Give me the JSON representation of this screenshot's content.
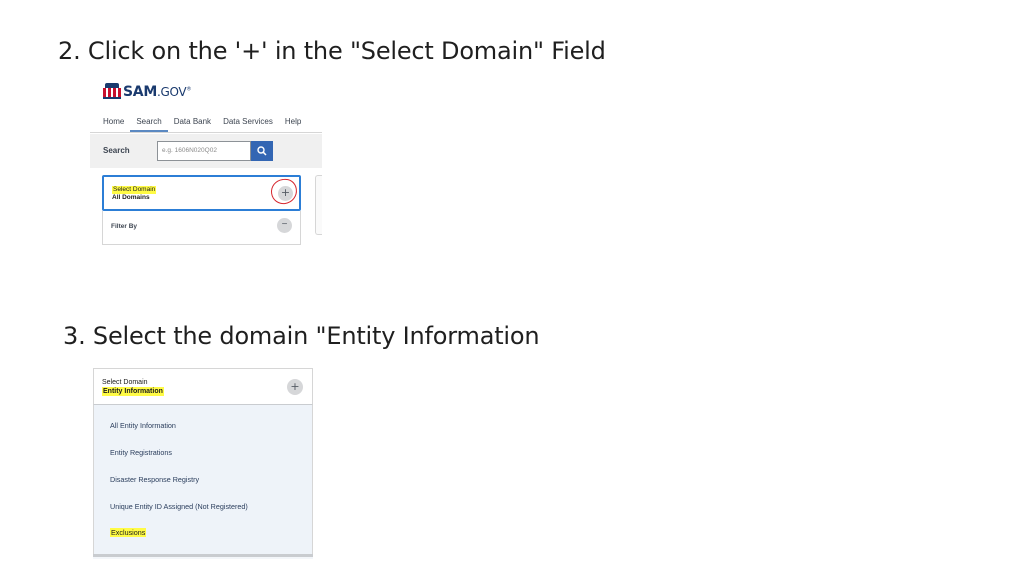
{
  "steps": {
    "step2": "2. Click on the '+' in the \"Select Domain\" Field",
    "step3": "3. Select the domain \"Entity Information"
  },
  "screenshot1": {
    "logo": {
      "main": "SAM",
      "suffix": ".GOV",
      "mark": "®"
    },
    "nav": [
      "Home",
      "Search",
      "Data Bank",
      "Data Services",
      "Help"
    ],
    "nav_active": "Search",
    "search": {
      "label": "Search",
      "placeholder": "e.g. 1606N020Q02"
    },
    "domain": {
      "label": "Select Domain",
      "value": "All Domains",
      "button": "+"
    },
    "filter": {
      "label": "Filter By",
      "button": "−"
    }
  },
  "screenshot2": {
    "domain": {
      "label": "Select Domain",
      "value": "Entity Information",
      "button": "+"
    },
    "options": [
      "All Entity Information",
      "Entity Registrations",
      "Disaster Response Registry",
      "Unique Entity ID Assigned (Not Registered)",
      "Exclusions"
    ]
  },
  "colors": {
    "highlight": "#fffb45",
    "annotation_circle": "#d6262e",
    "focus_border": "#2c7ed6",
    "search_button": "#3366b3"
  }
}
